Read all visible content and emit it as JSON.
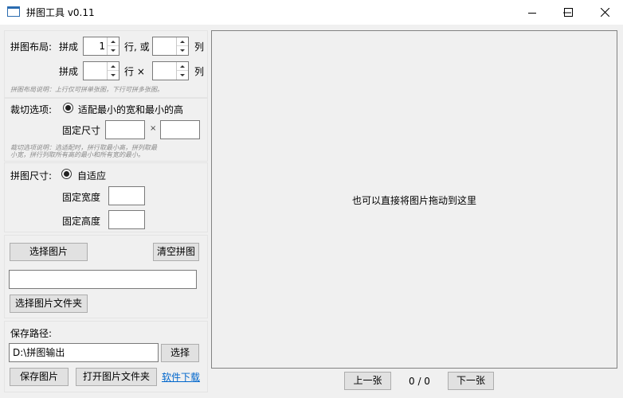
{
  "window": {
    "title": "拼图工具 v0.11",
    "controls": [
      "minimize-icon",
      "maximize-icon",
      "close-icon"
    ]
  },
  "layout_group": {
    "label": "拼图布局:",
    "row1": {
      "prefix": "拼成",
      "value": "1",
      "mid": "行, 或",
      "value2": "",
      "suffix": "列"
    },
    "row2": {
      "prefix": "拼成",
      "value": "",
      "mid": "行 ×",
      "value2": "",
      "suffix": "列"
    },
    "note": "拼图布局说明：上行仅可拼单张图，下行可拼多张图。"
  },
  "crop_group": {
    "label": "裁切选项:",
    "radio_label": "适配最小的宽和最小的高",
    "fixed_label": "固定尺寸",
    "width_value": "",
    "times": "×",
    "height_value": "",
    "note_line1": "裁切选项说明：选适配时，拼行取最小高，拼列取最",
    "note_line2": "小宽，拼行列取所有高的最小和所有宽的最小。"
  },
  "size_group": {
    "label": "拼图尺寸:",
    "radio_label": "自适应",
    "width_label": "固定宽度",
    "width_value": "",
    "height_label": "固定高度",
    "height_value": ""
  },
  "image_group": {
    "select_images": "选择图片",
    "clear": "清空拼图",
    "path_value": "",
    "select_folder": "选择图片文件夹"
  },
  "save_group": {
    "label": "保存路径:",
    "path_value": "D:\\拼图输出",
    "browse": "选择",
    "save": "保存图片",
    "open_folder": "打开图片文件夹",
    "download_link": "软件下载"
  },
  "preview": {
    "hint": "也可以直接将图片拖动到这里",
    "prev": "上一张",
    "counter": "0 / 0",
    "next": "下一张"
  }
}
